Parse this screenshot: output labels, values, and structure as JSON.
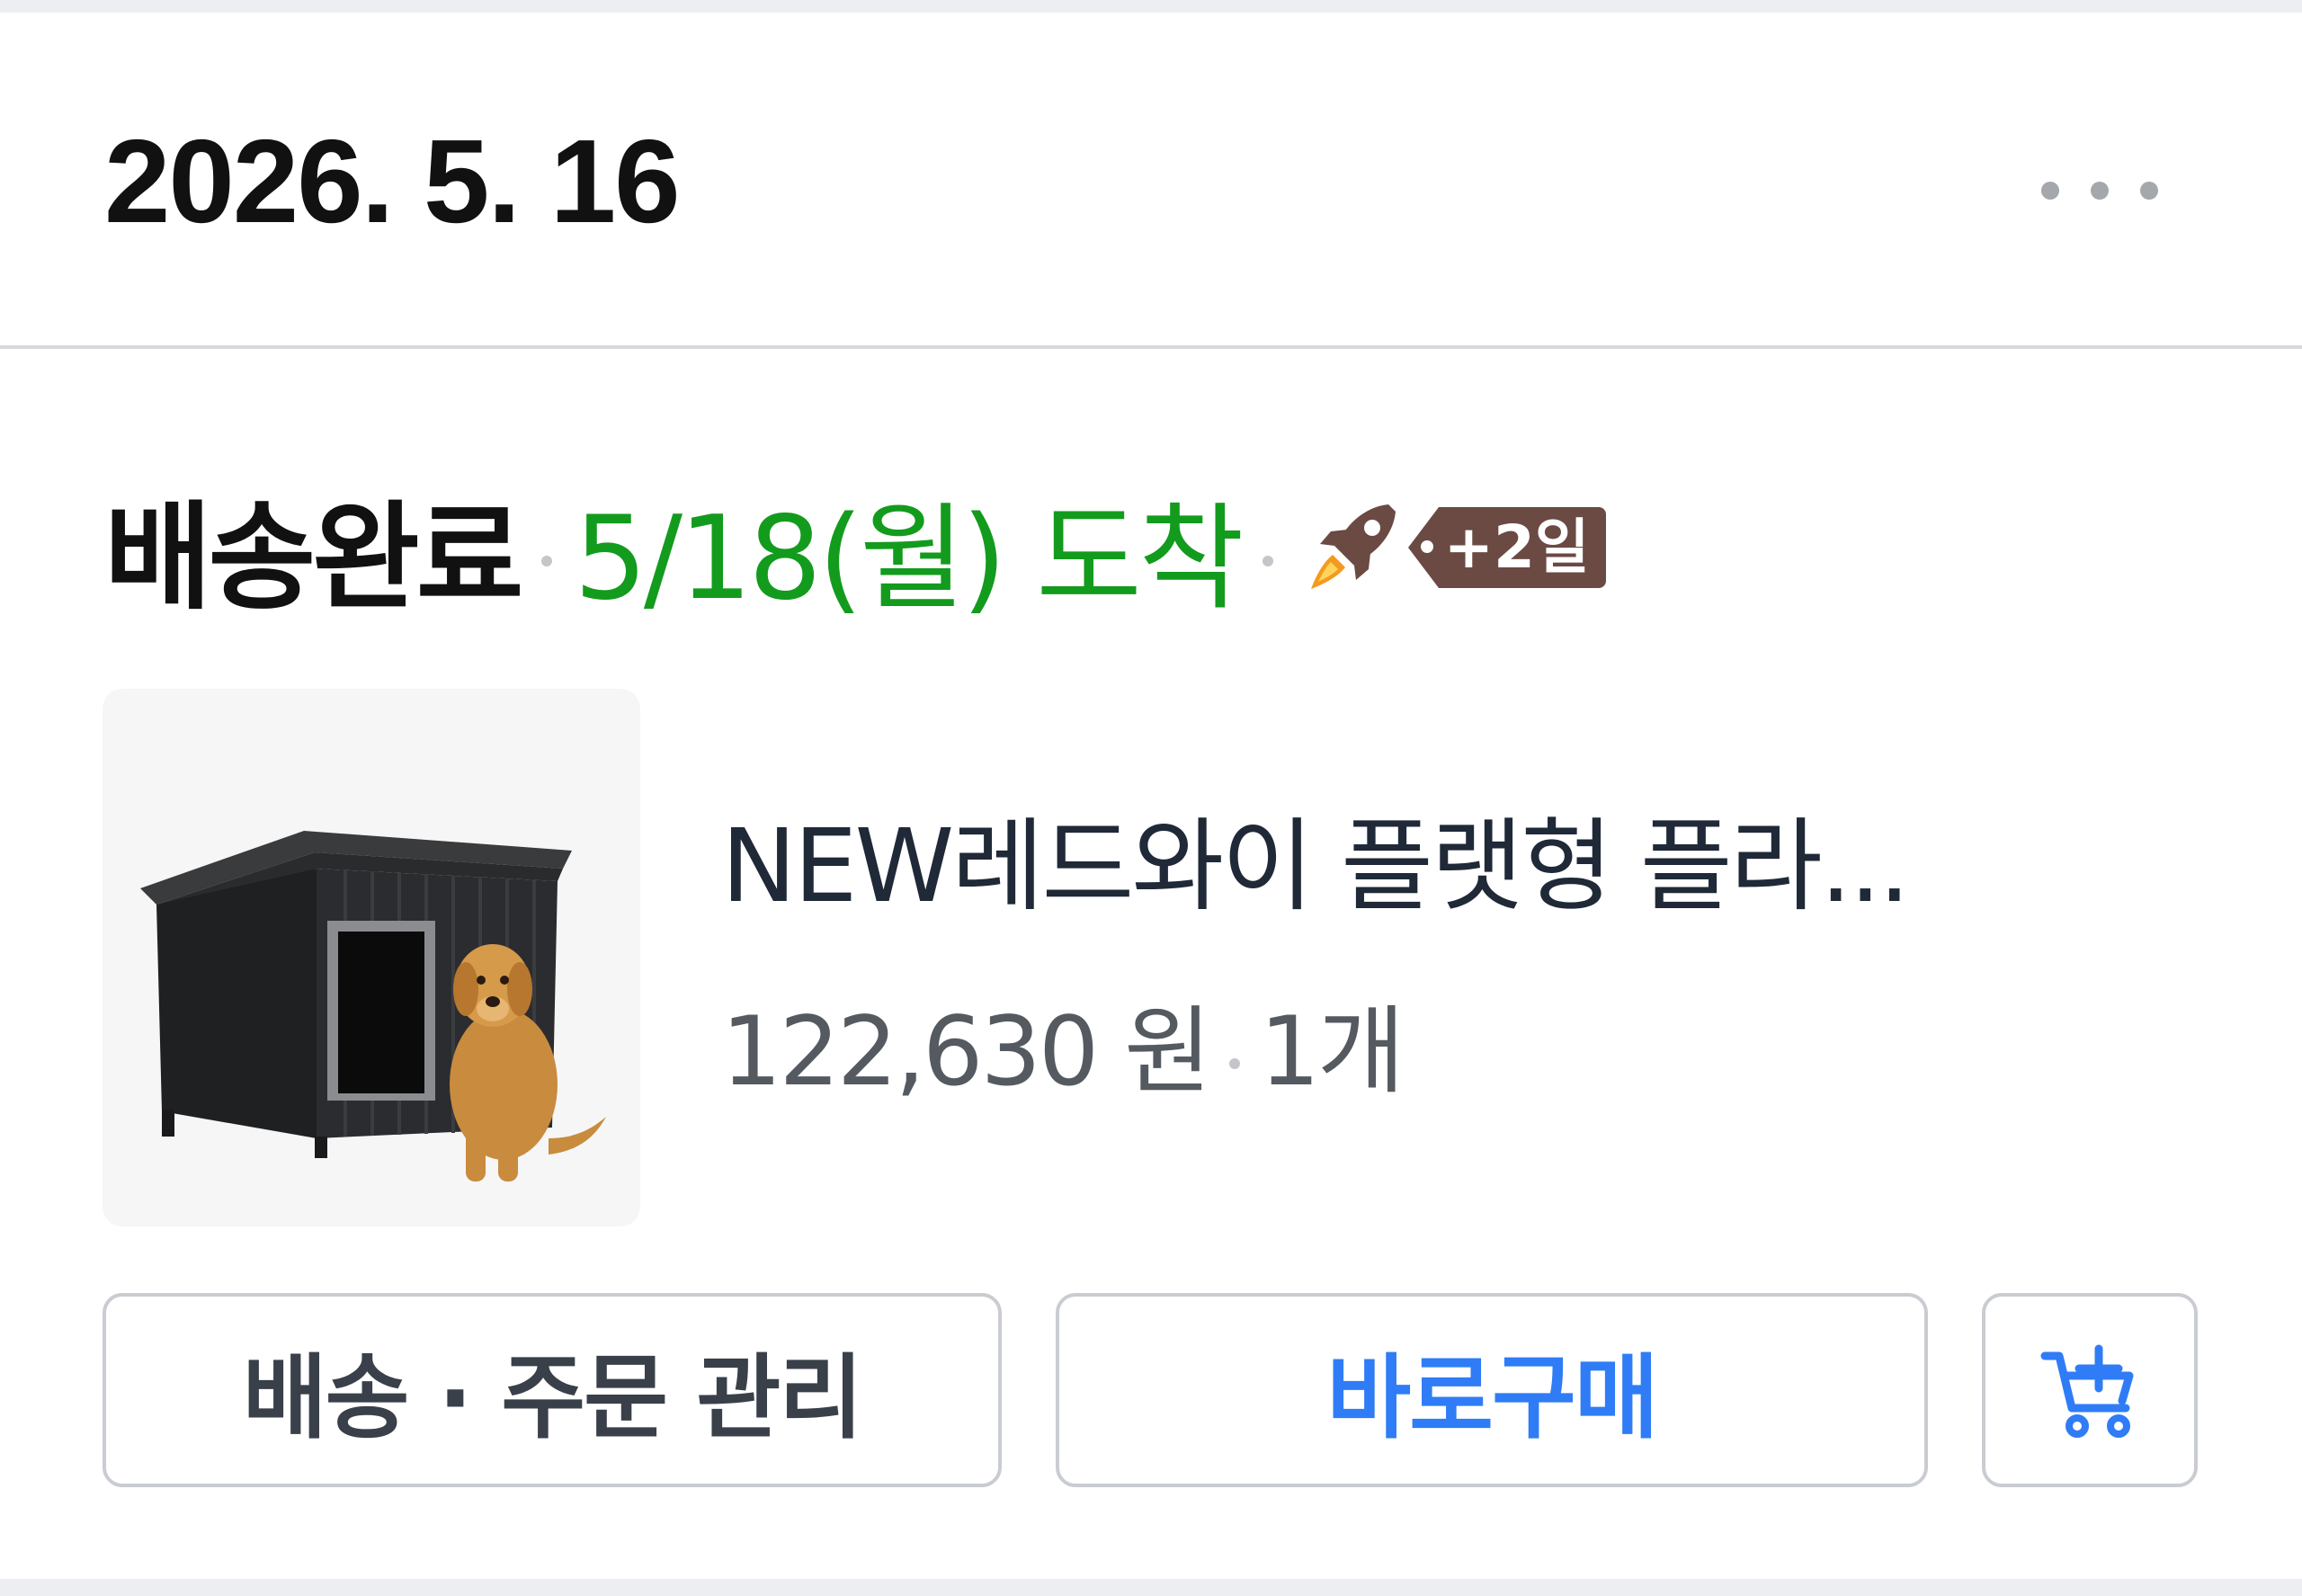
{
  "order": {
    "date": "2026. 5. 16",
    "more_icon": "more-horizontal-icon"
  },
  "shipment": {
    "status": "배송완료",
    "arrival": "5/18(월) 도착",
    "rocket_icon": "rocket-icon",
    "badge": "+2일",
    "arrival_color": "#139b1d",
    "badge_color": "#6b4a44"
  },
  "product": {
    "image_alt": "dog-house-product-image",
    "title": "NEW레드와이 플랫형 플라...",
    "price": "122,630 원",
    "quantity": "1개"
  },
  "actions": {
    "manage_label": "배송 · 주문 관리",
    "buy_label": "바로구매",
    "buy_color": "#2f7cf6",
    "cart_icon": "add-to-cart-icon"
  }
}
